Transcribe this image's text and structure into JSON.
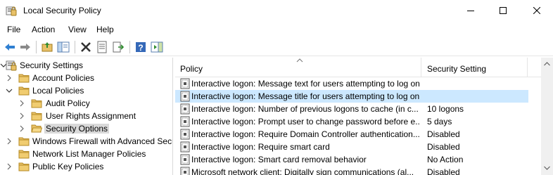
{
  "window": {
    "title": "Local Security Policy",
    "minimize_icon": "minimize-icon",
    "maximize_icon": "maximize-icon",
    "close_icon": "close-icon"
  },
  "menu": [
    "File",
    "Action",
    "View",
    "Help"
  ],
  "toolbar": {
    "buttons": [
      "back-icon",
      "forward-icon",
      "up-folder-icon",
      "show-hide-tree-icon",
      "delete-icon",
      "properties-icon",
      "export-list-icon",
      "help-icon",
      "show-action-pane-icon"
    ]
  },
  "tree": {
    "items": [
      {
        "label": "Security Settings",
        "icon": "security-settings-icon",
        "expander": "chevron-down"
      },
      {
        "label": "Account Policies",
        "icon": "folder-icon",
        "expander": "chevron-right"
      },
      {
        "label": "Local Policies",
        "icon": "folder-icon",
        "expander": "chevron-down"
      },
      {
        "label": "Audit Policy",
        "icon": "folder-icon",
        "expander": "chevron-right"
      },
      {
        "label": "User Rights Assignment",
        "icon": "folder-icon",
        "expander": "chevron-right"
      },
      {
        "label": "Security Options",
        "icon": "folder-open-icon",
        "expander": "chevron-right",
        "selected": true
      },
      {
        "label": "Windows Firewall with Advanced Secu",
        "icon": "folder-icon",
        "expander": "chevron-right"
      },
      {
        "label": "Network List Manager Policies",
        "icon": "folder-icon",
        "expander": ""
      },
      {
        "label": "Public Key Policies",
        "icon": "folder-icon",
        "expander": "chevron-right"
      }
    ]
  },
  "list": {
    "columns": {
      "policy": "Policy",
      "setting": "Security Setting"
    },
    "sort_icon": "sort-up-icon",
    "rows": [
      {
        "policy": "Interactive logon: Message text for users attempting to log on",
        "setting": ""
      },
      {
        "policy": "Interactive logon: Message title for users attempting to log on",
        "setting": "",
        "selected": true
      },
      {
        "policy": "Interactive logon: Number of previous logons to cache (in c...",
        "setting": "10 logons"
      },
      {
        "policy": "Interactive logon: Prompt user to change password before e...",
        "setting": "5 days"
      },
      {
        "policy": "Interactive logon: Require Domain Controller authentication...",
        "setting": "Disabled"
      },
      {
        "policy": "Interactive logon: Require smart card",
        "setting": "Disabled"
      },
      {
        "policy": "Interactive logon: Smart card removal behavior",
        "setting": "No Action"
      },
      {
        "policy": "Microsoft network client: Digitally sign communications (al...",
        "setting": "Disabled"
      }
    ]
  },
  "colors": {
    "selection_row": "#cce8ff",
    "tree_selected": "#d9d9d9",
    "folder": "#e8c168"
  }
}
